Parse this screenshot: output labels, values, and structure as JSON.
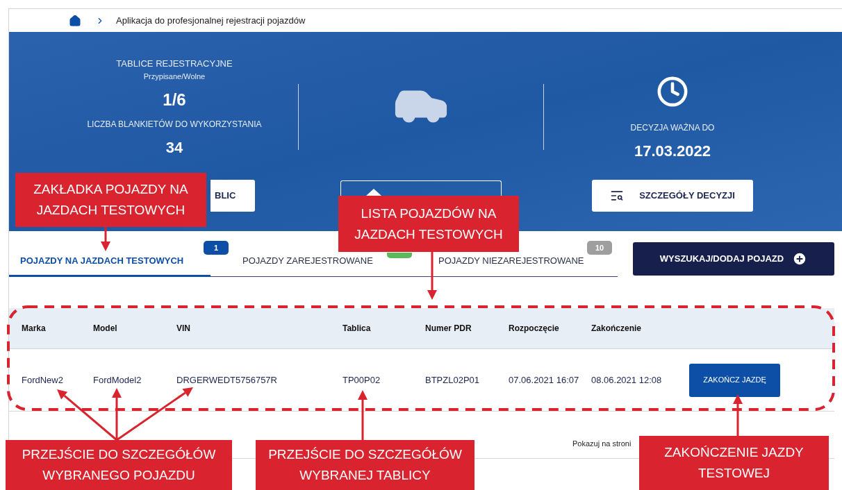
{
  "breadcrumb": {
    "title": "Aplikacja do profesjonalnej rejestracji pojazdów"
  },
  "hero": {
    "plates": {
      "title": "TABLICE REJESTRACYJNE",
      "subtitle": "Przypisane/Wolne",
      "value": "1/6"
    },
    "blanks": {
      "title": "LICZBA BLANKIETÓW DO WYKORZYSTANIA",
      "value": "34"
    },
    "decision": {
      "title": "DECYZJA WAŻNA DO",
      "value": "17.03.2022"
    },
    "buttons": [
      "BLIC",
      "SZCZEGÓŁY DECYZJI"
    ]
  },
  "tabs": [
    {
      "label": "POJAZDY NA JAZDACH TESTOWYCH",
      "selected": true,
      "badge": {
        "text": "1",
        "color": "#0d4ea6"
      }
    },
    {
      "label": "POJAZDY ZAREJESTROWANE",
      "selected": false,
      "badge": {
        "color": "#5cb85c"
      }
    },
    {
      "label": "POJAZDY NIEZAREJESTROWANE",
      "selected": false,
      "badge": {
        "text": "10",
        "color": "#9e9e9e"
      }
    }
  ],
  "action_button": "WYSZUKAJ/DODAJ POJAZD",
  "table": {
    "columns": [
      "Marka",
      "Model",
      "VIN",
      "Tablica",
      "Numer PDR",
      "Rozpoczęcie",
      "Zakończenie"
    ],
    "rows": [
      {
        "cells": [
          "FordNew2",
          "FordModel2",
          "DRGERWEDT5756757R",
          "TP00P02",
          "BTPZL02P01",
          "07.06.2021 16:07",
          "08.06.2021 12:08"
        ],
        "action": "ZAKOŃCZ JAZDĘ"
      }
    ]
  },
  "pagination": {
    "label": "Pokazuj na stroni"
  },
  "annotations": [
    {
      "text": "ZAKŁADKA POJAZDY NA\nJAZDACH TESTOWYCH"
    },
    {
      "text": "LISTA POJAZDÓW NA\nJAZDACH TESTOWYCH"
    },
    {
      "text": "PRZEJŚCIE DO SZCZEGÓŁÓW\nWYBRANEGO POJAZDU"
    },
    {
      "text": "PRZEJŚCIE DO SZCZEGÓŁÓW\nWYBRANEJ TABLICY"
    },
    {
      "text": "ZAKOŃCZENIE JAZDY\nTESTOWEJ"
    }
  ]
}
